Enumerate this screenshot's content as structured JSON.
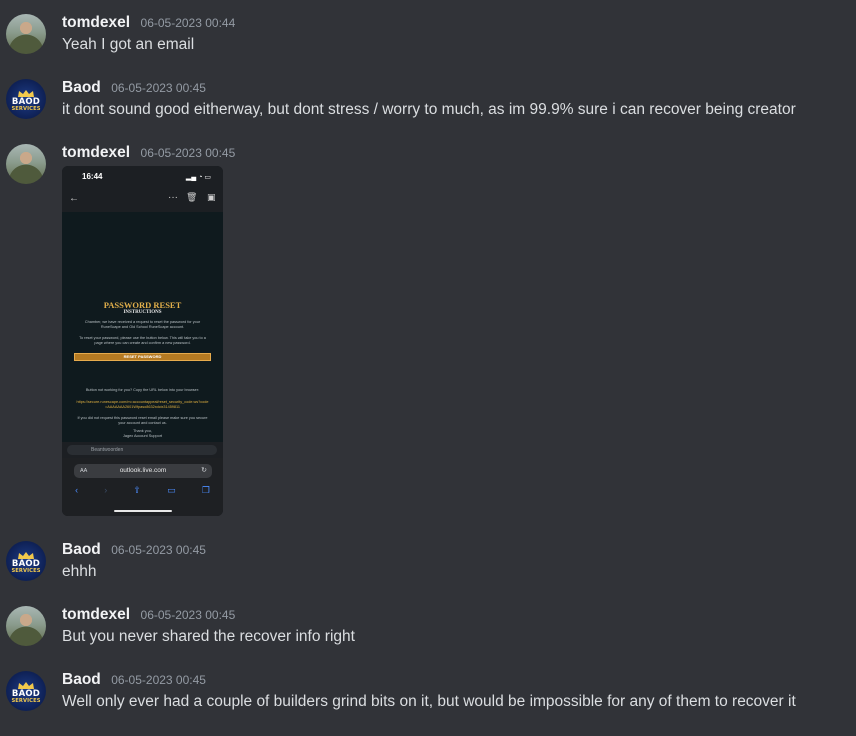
{
  "messages": [
    {
      "author": "tomdexel",
      "timestamp": "06-05-2023 00:44",
      "text": "Yeah I got an email",
      "avatar": "tomdexel-avatar"
    },
    {
      "author": "Baod",
      "timestamp": "06-05-2023 00:45",
      "text": "it dont sound good eitherway, but dont stress / worry to much, as im 99.9% sure i can recover being creator",
      "avatar": "baod-services-avatar"
    },
    {
      "author": "tomdexel",
      "timestamp": "06-05-2023 00:45",
      "text": "",
      "avatar": "tomdexel-avatar",
      "attachment": {
        "type": "image",
        "status_time": "16:44",
        "email_title": "PASSWORD RESET",
        "email_subtitle": "INSTRUCTIONS",
        "intro": "Chamber, we have received a request to reset the password for your RuneScape and Old School RuneScape account.",
        "instructions": "To reset your password, please use the button below. This will take you to a page where you can create and confirm a new password.",
        "button_label": "RESET PASSWORD",
        "fallback_text": "Button not working for you? Copy the URL below into your browser:",
        "link_text": "https://secure.runescape.com/m=accountappeal/reset_security_code.ws?code=AAAAAAA2601Wfpaso8632xdcix31459811",
        "warning": "If you did not request this password reset email please make sure you secure your account and contact us.",
        "sign_thanks": "Thank you,",
        "sign_team": "Jagex Account Support",
        "reply_placeholder": "Beantwoorden",
        "browser_aa": "AA",
        "browser_url": "outlook.live.com"
      }
    },
    {
      "author": "Baod",
      "timestamp": "06-05-2023 00:45",
      "text": "ehhh",
      "avatar": "baod-services-avatar"
    },
    {
      "author": "tomdexel",
      "timestamp": "06-05-2023 00:45",
      "text": "But you never shared the recover info right",
      "avatar": "tomdexel-avatar"
    },
    {
      "author": "Baod",
      "timestamp": "06-05-2023 00:45",
      "text": "Well only ever had a couple of builders grind bits on it, but would be impossible for any of them to recover it",
      "avatar": "baod-services-avatar"
    }
  ],
  "baod_logo": {
    "line1": "BAOD",
    "line2": "SERVICES"
  },
  "colors": {
    "background": "#313338",
    "username": "#f2f3f5",
    "timestamp": "#949ba4",
    "text": "#dbdee1"
  }
}
